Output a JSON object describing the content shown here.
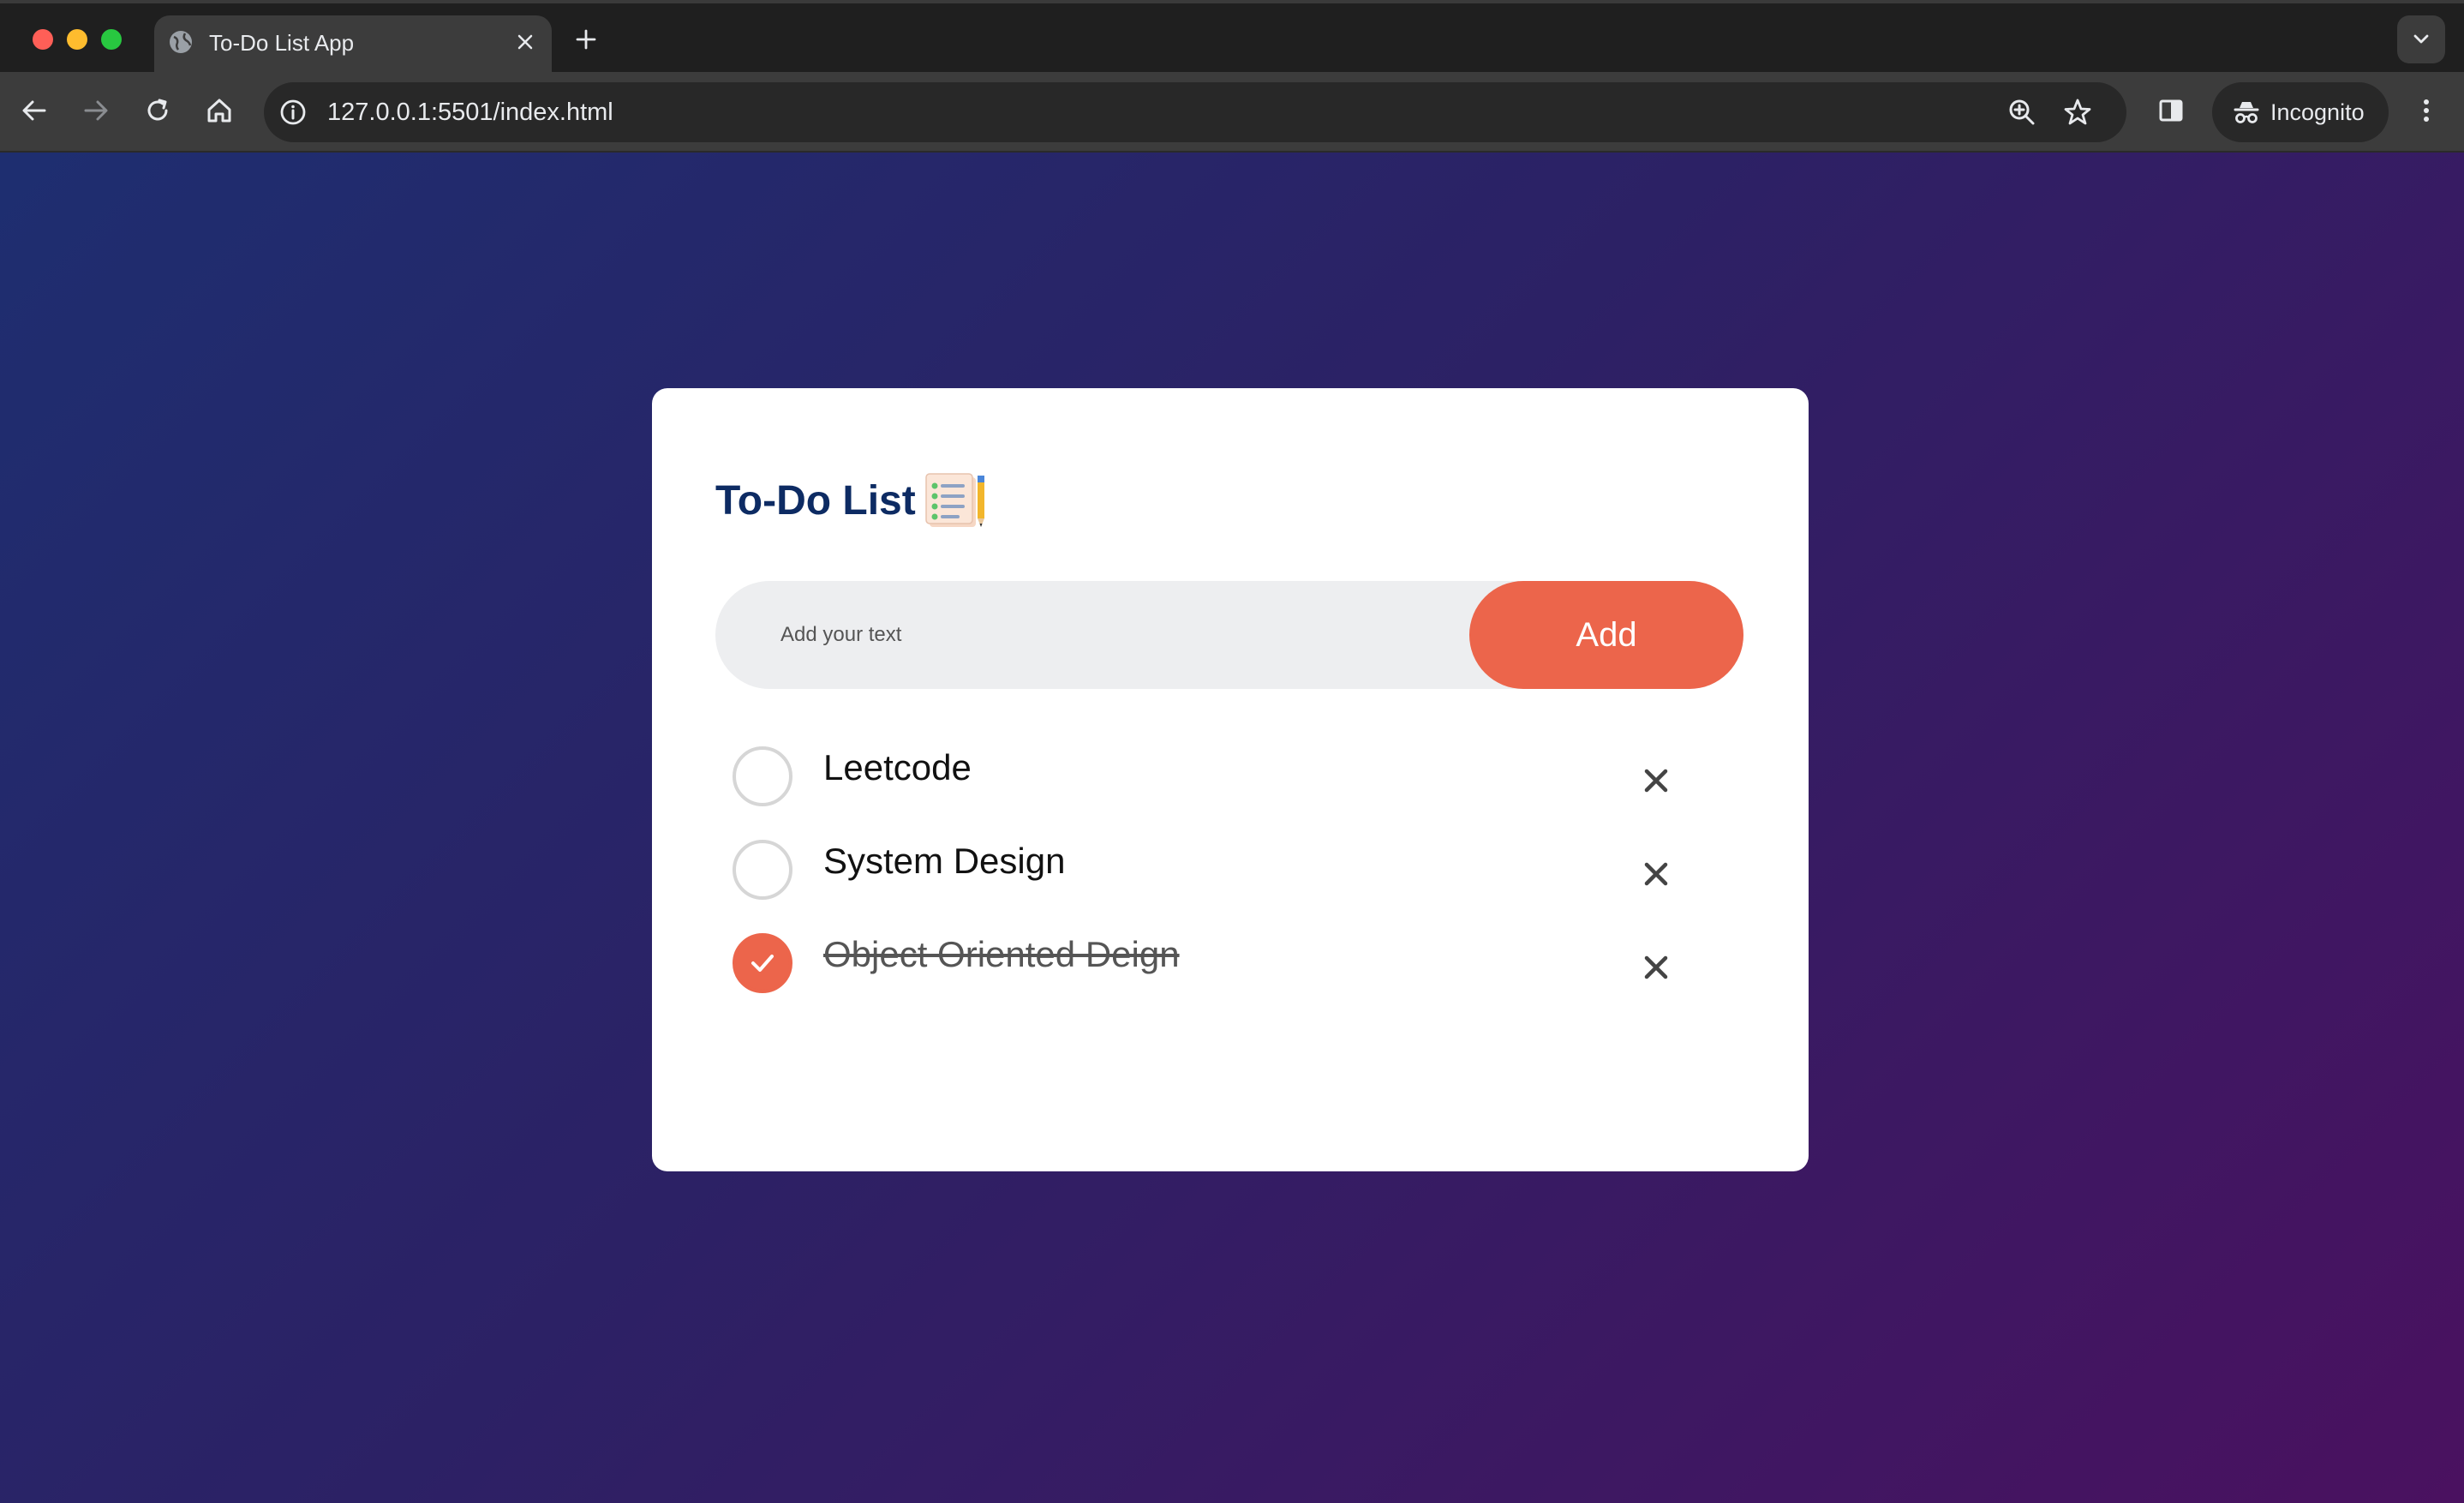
{
  "browser": {
    "tab_title": "To-Do List App",
    "url": "127.0.0.1:5501/index.html",
    "incognito_label": "Incognito",
    "icons": {
      "tab": "globe-icon",
      "tab_close": "close-icon",
      "new_tab": "plus-icon",
      "back": "arrow-left-icon",
      "forward": "arrow-right-icon",
      "reload": "reload-icon",
      "home": "home-icon",
      "site_info": "info-icon",
      "zoom": "zoom-icon",
      "bookmark": "star-icon",
      "side_panel": "side-panel-icon",
      "incognito": "incognito-icon",
      "menu": "kebab-menu-icon",
      "tab_search": "chevron-down-icon"
    }
  },
  "app": {
    "title": "To-Do List",
    "title_icon": "notepad-pencil-icon",
    "input": {
      "placeholder": "Add your text",
      "value": ""
    },
    "add_button_label": "Add",
    "tasks": [
      {
        "text": "Leetcode",
        "completed": false
      },
      {
        "text": "System Design",
        "completed": false
      },
      {
        "text": "Object Oriented Deign",
        "completed": true
      }
    ]
  },
  "colors": {
    "accent": "#ec654b",
    "title": "#0d2b63",
    "gradient_start": "#1e2e70",
    "gradient_end": "#4a1160"
  }
}
